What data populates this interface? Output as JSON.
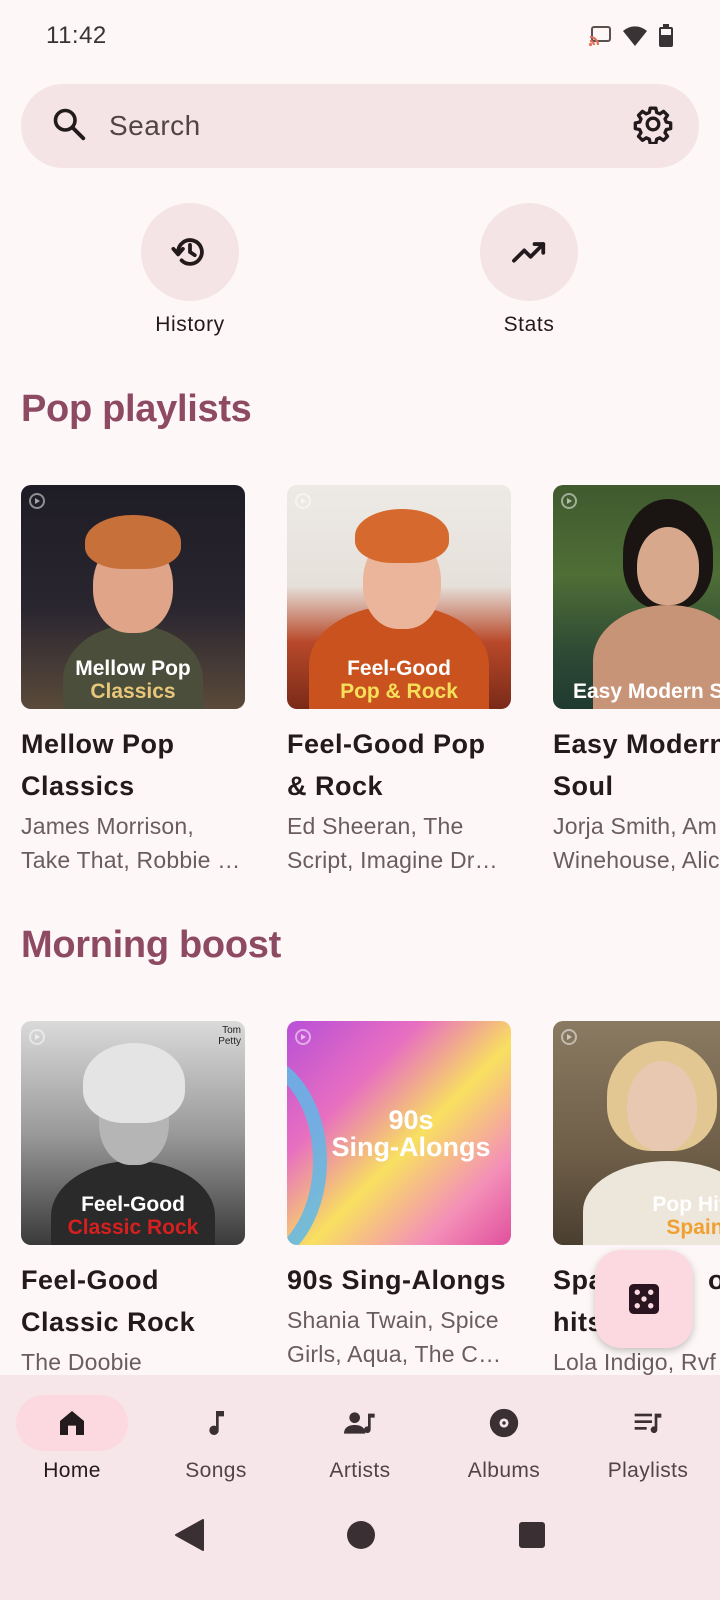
{
  "status_bar": {
    "time": "11:42",
    "icons": [
      "cast-icon",
      "wifi-icon",
      "battery-icon"
    ]
  },
  "search": {
    "placeholder": "Search"
  },
  "quick_actions": [
    {
      "label": "History",
      "icon": "history-icon"
    },
    {
      "label": "Stats",
      "icon": "trending-up-icon"
    }
  ],
  "sections": [
    {
      "title": "Pop playlists",
      "playlists": [
        {
          "title_line1": "Mellow Pop",
          "title_line2": "Classics",
          "subtitle_line1": "James Morrison,",
          "subtitle_line2": "Take That, Robbie …",
          "cover_line1": "Mellow Pop",
          "cover_line2": "Classics",
          "cover_accent": "#E8C77A"
        },
        {
          "title_line1": "Feel-Good Pop",
          "title_line2": "& Rock",
          "subtitle_line1": "Ed Sheeran, The",
          "subtitle_line2": "Script, Imagine Dr…",
          "cover_line1": "Feel-Good",
          "cover_line2": "Pop & Rock",
          "cover_accent": "#F6E05A"
        },
        {
          "title_line1": "Easy Modern",
          "title_line2": "Soul",
          "subtitle_line1": "Jorja Smith, Am",
          "subtitle_line2": "Winehouse, Alic",
          "cover_line1": "Easy Modern S",
          "cover_line2": "",
          "cover_accent": "#FFFFFF"
        }
      ]
    },
    {
      "title": "Morning boost",
      "playlists": [
        {
          "title_line1": "Feel-Good",
          "title_line2": "Classic Rock",
          "subtitle_line1": "The Doobie",
          "subtitle_line2": "",
          "cover_line1": "Feel-Good",
          "cover_line2": "Classic Rock",
          "cover_accent": "#D61F1F",
          "cover_tag": "Tom Petty"
        },
        {
          "title_line1": "90s Sing-Alongs",
          "title_line2": "",
          "subtitle_line1": "Shania Twain, Spice",
          "subtitle_line2": "Girls, Aqua, The C…",
          "cover_line1": "90s",
          "cover_line2": "Sing-Alongs",
          "cover_accent": "#FFFFFF"
        },
        {
          "title_line1": "Spa",
          "title_line2": "hits",
          "title_line1_tail": "op",
          "subtitle_line1": "Lola Indigo, Rvf",
          "subtitle_line2": "",
          "cover_line1": "Pop Hits",
          "cover_line2": "Spain",
          "cover_accent": "#F0A030"
        }
      ]
    }
  ],
  "fab": {
    "icon": "dice-icon"
  },
  "bottom_nav": [
    {
      "label": "Home",
      "icon": "home-icon",
      "active": true
    },
    {
      "label": "Songs",
      "icon": "music-note-icon",
      "active": false
    },
    {
      "label": "Artists",
      "icon": "artist-icon",
      "active": false
    },
    {
      "label": "Albums",
      "icon": "album-icon",
      "active": false
    },
    {
      "label": "Playlists",
      "icon": "playlist-icon",
      "active": false
    }
  ],
  "system_nav": [
    "back-button",
    "home-button",
    "recents-button"
  ],
  "colors": {
    "background": "#FDF7F7",
    "accent": "#8D4A62",
    "surface": "#F5E4E6",
    "nav_active": "#FCD9E1"
  }
}
